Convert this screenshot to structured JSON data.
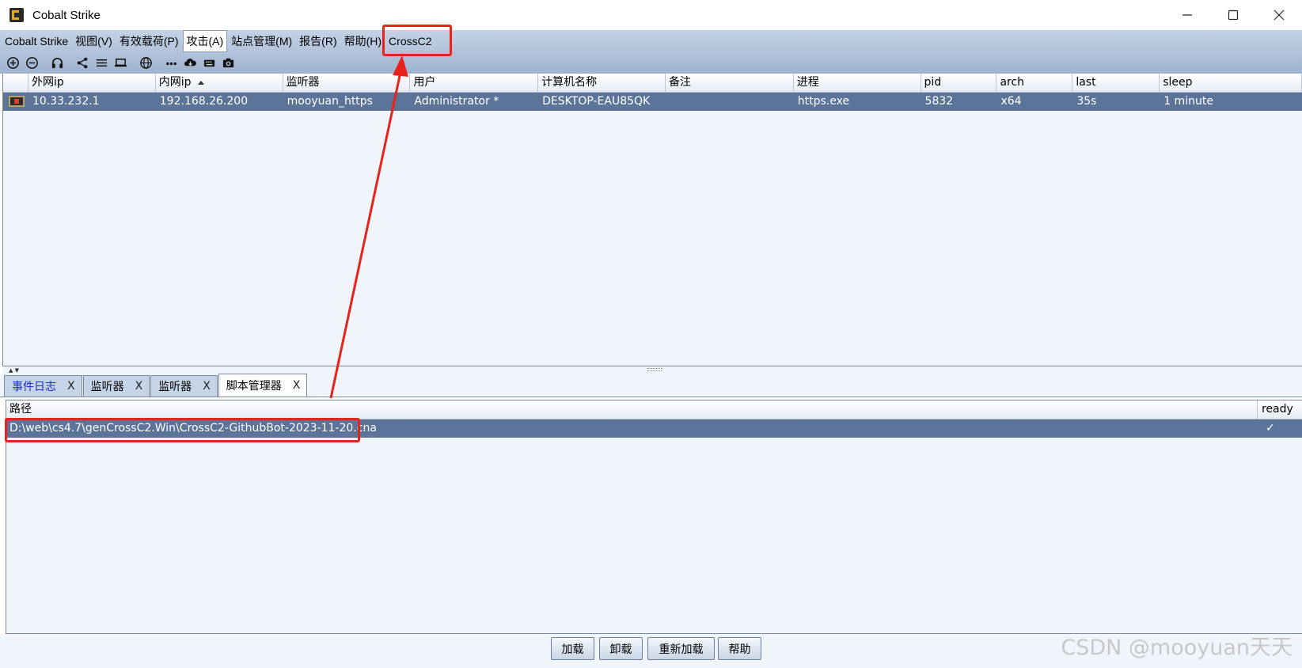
{
  "window": {
    "title": "Cobalt Strike",
    "controls": [
      "minimize-icon",
      "maximize-icon",
      "close-icon"
    ]
  },
  "menubar": {
    "items": [
      {
        "label": "Cobalt Strike"
      },
      {
        "label": "视图(V)"
      },
      {
        "label": "有效载荷(P)"
      },
      {
        "label": "攻击(A)",
        "active": true
      },
      {
        "label": "站点管理(M)"
      },
      {
        "label": "报告(R)"
      },
      {
        "label": "帮助(H)"
      },
      {
        "label": "CrossC2"
      }
    ]
  },
  "toolbar": {
    "icons": [
      "add-icon",
      "remove-icon",
      "headphones-icon",
      "share-icon",
      "list-icon",
      "laptop-icon",
      "globe-icon",
      "dots-icon",
      "cloud-download-icon",
      "keyboard-icon",
      "camera-icon"
    ]
  },
  "beacons": {
    "columns": [
      "",
      "外网ip",
      "内网ip",
      "监听器",
      "用户",
      "计算机名称",
      "备注",
      "进程",
      "pid",
      "arch",
      "last",
      "sleep"
    ],
    "sorted_column": "内网ip",
    "rows": [
      {
        "external_ip": "10.33.232.1",
        "internal_ip": "192.168.26.200",
        "listener": "mooyuan_https",
        "user": "Administrator *",
        "computer": "DESKTOP-EAU85QK",
        "note": "",
        "process": "https.exe",
        "pid": "5832",
        "arch": "x64",
        "last": "35s",
        "sleep": "1 minute"
      }
    ]
  },
  "tabs": [
    {
      "label": "事件日志",
      "close": "X"
    },
    {
      "label": "监听器",
      "close": "X"
    },
    {
      "label": "监听器",
      "close": "X"
    },
    {
      "label": "脚本管理器",
      "close": "X",
      "selected": true
    }
  ],
  "scripts": {
    "columns": [
      "路径",
      "ready"
    ],
    "rows": [
      {
        "path": "D:\\web\\cs4.7\\genCrossC2.Win\\CrossC2-GithubBot-2023-11-20.cna",
        "ready": "✓"
      }
    ]
  },
  "buttons": {
    "load": "加载",
    "unload": "卸载",
    "reload": "重新加载",
    "help": "帮助"
  },
  "watermark": "CSDN @mooyuan天天",
  "colors": {
    "selection": "#5c7497",
    "annotation": "#e8231c",
    "chrome_top": "#c4d3e6",
    "chrome_bottom": "#9fb3cf"
  }
}
